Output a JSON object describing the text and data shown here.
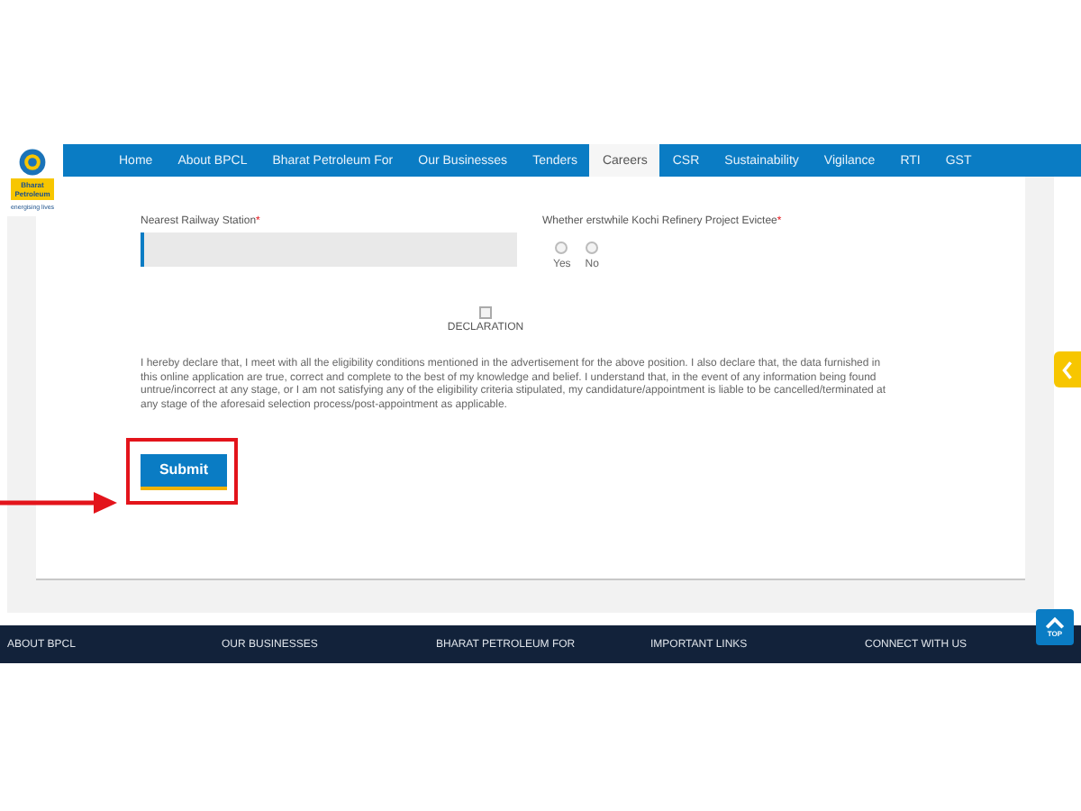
{
  "logo": {
    "name": "Bharat Petroleum",
    "tagline": "energising lives"
  },
  "nav": [
    {
      "label": "Home",
      "selected": false
    },
    {
      "label": "About BPCL",
      "selected": false
    },
    {
      "label": "Bharat Petroleum For",
      "selected": false
    },
    {
      "label": "Our Businesses",
      "selected": false
    },
    {
      "label": "Tenders",
      "selected": false
    },
    {
      "label": "Careers",
      "selected": true
    },
    {
      "label": "CSR",
      "selected": false
    },
    {
      "label": "Sustainability",
      "selected": false
    },
    {
      "label": "Vigilance",
      "selected": false
    },
    {
      "label": "RTI",
      "selected": false
    },
    {
      "label": "GST",
      "selected": false
    }
  ],
  "form": {
    "station": {
      "label": "Nearest Railway Station",
      "mark": "*"
    },
    "evictee": {
      "label": "Whether erstwhile Kochi Refinery Project Evictee",
      "mark": "*",
      "options": [
        {
          "label": "Yes",
          "selected": false
        },
        {
          "label": "No",
          "selected": false
        }
      ]
    },
    "declaration": {
      "label": "DECLARATION",
      "checked": false,
      "text": "I hereby declare that, I meet with all the eligibility conditions mentioned in the advertisement for the above position. I also declare that, the data furnished in this online application are true, correct and complete to the best of my knowledge and belief. I understand that, in the event of any information being found untrue/incorrect at any stage, or I am not satisfying any of the eligibility criteria stipulated, my candidature/appointment is liable to be cancelled/terminated at any stage of the aforesaid selection process/post-appointment as applicable."
    },
    "submit": "Submit"
  },
  "footer": [
    "ABOUT BPCL",
    "OUR BUSINESSES",
    "BHARAT PETROLEUM FOR",
    "IMPORTANT LINKS",
    "CONNECT WITH US"
  ],
  "top_button": "TOP"
}
